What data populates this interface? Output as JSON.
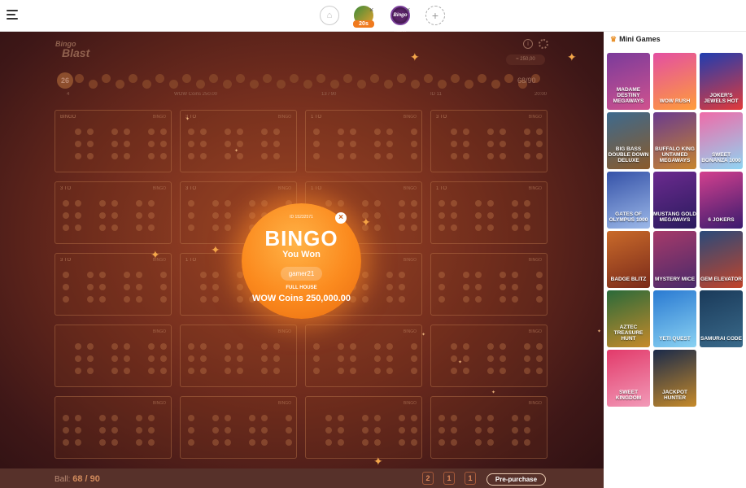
{
  "topbar": {
    "tabs": [
      {
        "name": "tab-game-1",
        "badge": "20s",
        "close": "×"
      },
      {
        "name": "tab-game-2",
        "label": "Bingo Blast",
        "close": "×"
      }
    ],
    "home_glyph": "⌂",
    "add_glyph": "+"
  },
  "game": {
    "logo_line1": "Bingo",
    "logo_line2": "Blast",
    "balance": "≈ 250,00",
    "first_ball": "26",
    "draw_count": "68/90",
    "stats": {
      "players": "4",
      "pot": "WOW Coins 250.00",
      "cards": "13 / 90",
      "round_id": "ID 11",
      "time": "20:00"
    },
    "card_titles": [
      "BINGO",
      "3 TO",
      "1 TO",
      "3 TO",
      "3 TO",
      "3 TO",
      "1 TO",
      "1 TO",
      "3 TO",
      "1 TO",
      "",
      "",
      "",
      "",
      "",
      "",
      "",
      "",
      "",
      ""
    ],
    "card_right_label": "BINGO",
    "popup": {
      "id": "ID 15232571",
      "title": "BINGO",
      "won": "You Won",
      "user": "gamer21",
      "pattern": "FULL HOUSE",
      "prize": "WOW Coins 250,000.00",
      "close": "×"
    }
  },
  "bottombar": {
    "label": "Ball:",
    "count": "68 / 90",
    "qty": [
      "2",
      "1",
      "1"
    ],
    "prepurchase": "Pre-purchase"
  },
  "sidebar": {
    "title": "Mini Games",
    "games": [
      {
        "name": "MADAME DESTINY MEGAWAYS",
        "color1": "#7a3b9b",
        "color2": "#d0528e"
      },
      {
        "name": "WOW RUSH",
        "color1": "#e34fa2",
        "color2": "#ff9c3a"
      },
      {
        "name": "JOKER'S JEWELS HOT",
        "color1": "#1f3db0",
        "color2": "#e23a3a"
      },
      {
        "name": "BIG BASS DOUBLE DOWN DELUXE",
        "color1": "#3d6a8e",
        "color2": "#8a5a2a"
      },
      {
        "name": "BUFFALO KING UNTAMED MEGAWAYS",
        "color1": "#6a3b8e",
        "color2": "#c6842e"
      },
      {
        "name": "SWEET BONANZA 1000",
        "color1": "#ef6ba8",
        "color2": "#8fd4f2"
      },
      {
        "name": "GATES OF OLYMPUS 1000",
        "color1": "#3552a8",
        "color2": "#9cb8e8"
      },
      {
        "name": "MUSTANG GOLD MEGAWAYS",
        "color1": "#6b2a8e",
        "color2": "#2a1b5e"
      },
      {
        "name": "6 JOKERS",
        "color1": "#d3408e",
        "color2": "#3a1b6e"
      },
      {
        "name": "BADGE BLITZ",
        "color1": "#c96a2a",
        "color2": "#7a2a1a"
      },
      {
        "name": "MYSTERY MICE",
        "color1": "#a63a6a",
        "color2": "#4a2a6a"
      },
      {
        "name": "GEM ELEVATOR",
        "color1": "#2a4a7a",
        "color2": "#c2442a"
      },
      {
        "name": "AZTEC TREASURE HUNT",
        "color1": "#2a6a3a",
        "color2": "#c68a2a"
      },
      {
        "name": "YETI QUEST",
        "color1": "#2a7ad2",
        "color2": "#8ad2f2"
      },
      {
        "name": "SAMURAI CODE",
        "color1": "#1a3a5a",
        "color2": "#3a6a8a"
      },
      {
        "name": "SWEET KINGDOM",
        "color1": "#e23a6a",
        "color2": "#f29ab8"
      },
      {
        "name": "JACKPOT HUNTER",
        "color1": "#1a2a4a",
        "color2": "#c68a2a"
      }
    ]
  }
}
